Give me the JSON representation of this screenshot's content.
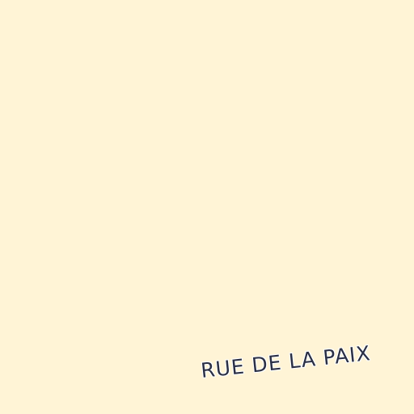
{
  "map": {
    "background_color": "#fff4d6",
    "street_label": "RUE DE LA PAIX",
    "label_color": "#2a2f45",
    "label_halo_color": "#ffffff"
  }
}
